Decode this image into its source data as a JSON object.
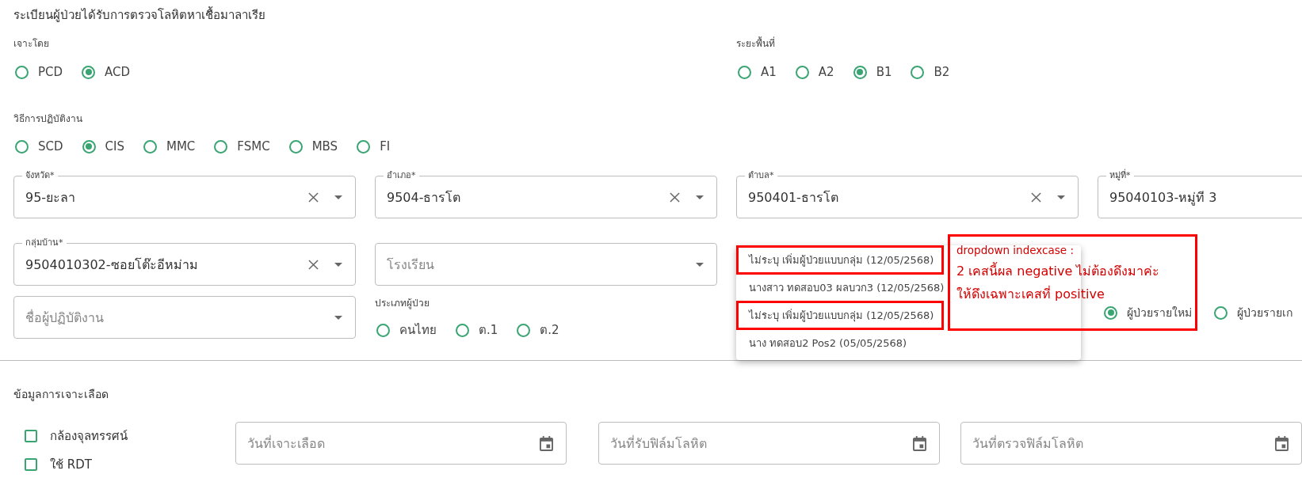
{
  "form_title": "ระเบียนผู้ป่วยได้รับการตรวจโลหิตหาเชื้อมาลาเรีย",
  "puncture_by": {
    "label": "เจาะโดย",
    "options": [
      {
        "label": "PCD",
        "selected": false
      },
      {
        "label": "ACD",
        "selected": true
      }
    ]
  },
  "area_stage": {
    "label": "ระยะพื้นที่",
    "options": [
      {
        "label": "A1",
        "selected": false
      },
      {
        "label": "A2",
        "selected": false
      },
      {
        "label": "B1",
        "selected": true
      },
      {
        "label": "B2",
        "selected": false
      }
    ]
  },
  "method": {
    "label": "วิธีการปฏิบัติงาน",
    "options": [
      {
        "label": "SCD",
        "selected": false
      },
      {
        "label": "CIS",
        "selected": true
      },
      {
        "label": "MMC",
        "selected": false
      },
      {
        "label": "FSMC",
        "selected": false
      },
      {
        "label": "MBS",
        "selected": false
      },
      {
        "label": "FI",
        "selected": false
      }
    ]
  },
  "location_fields": [
    {
      "label": "จังหวัด*",
      "value": "95-ยะลา",
      "clearable": true,
      "dropdown": true
    },
    {
      "label": "อำเภอ*",
      "value": "9504-ธารโต",
      "clearable": true,
      "dropdown": true
    },
    {
      "label": "ตำบล*",
      "value": "950401-ธารโต",
      "clearable": true,
      "dropdown": true
    },
    {
      "label": "หมู่ที่*",
      "value": "95040103-หมู่ที 3",
      "clearable": false,
      "dropdown": false
    }
  ],
  "second_fields": [
    {
      "label": "กลุ่มบ้าน*",
      "value": "9504010302-ซอยโต๊ะอีหม่าม",
      "clearable": true,
      "dropdown": true
    },
    {
      "placeholder": "โรงเรียน",
      "clearable": false,
      "dropdown": true
    }
  ],
  "worker_field": {
    "placeholder": "ชื่อผู้ปฏิบัติงาน",
    "clearable": false,
    "dropdown": true
  },
  "patient_type": {
    "label": "ประเภทผู้ป่วย",
    "options": [
      {
        "label": "คนไทย",
        "selected": false
      },
      {
        "label": "ต.1",
        "selected": false
      },
      {
        "label": "ต.2",
        "selected": false
      }
    ]
  },
  "case_type": {
    "options": [
      {
        "label": "ผู้ป่วยรายใหม่",
        "selected": true
      },
      {
        "label": "ผู้ป่วยรายเก",
        "selected": false
      }
    ]
  },
  "indexcase_dropdown": {
    "items": [
      {
        "label": "ไม่ระบุ เพิ่มผู้ป่วยแบบกลุ่ม (12/05/2568)",
        "flagged": true
      },
      {
        "label": "นางสาว ทดสอบ03 ผลบวก3 (12/05/2568)",
        "flagged": false
      },
      {
        "label": "ไม่ระบุ เพิ่มผู้ป่วยแบบกลุ่ม (12/05/2568)",
        "flagged": true
      },
      {
        "label": "นาง ทดสอบ2 Pos2 (05/05/2568)",
        "flagged": false
      }
    ]
  },
  "annotation": {
    "heading": "dropdown indexcase :",
    "lines": [
      "2 เคสนี้ผล negative ไม่ต้องดึงมาค่ะ",
      "ให้ดึงเฉพาะเคสที่ positive"
    ]
  },
  "blood_section": {
    "title": "ข้อมูลการเจาะเลือด",
    "checkboxes": [
      {
        "label": "กล้องจุลทรรศน์",
        "checked": false
      },
      {
        "label": "ใช้ RDT",
        "checked": false
      }
    ],
    "date_fields": [
      {
        "placeholder": "วันที่เจาะเลือด"
      },
      {
        "placeholder": "วันที่รับฟิล์มโลหิต"
      },
      {
        "placeholder": "วันที่ตรวจฟิล์มโลหิต"
      }
    ]
  }
}
